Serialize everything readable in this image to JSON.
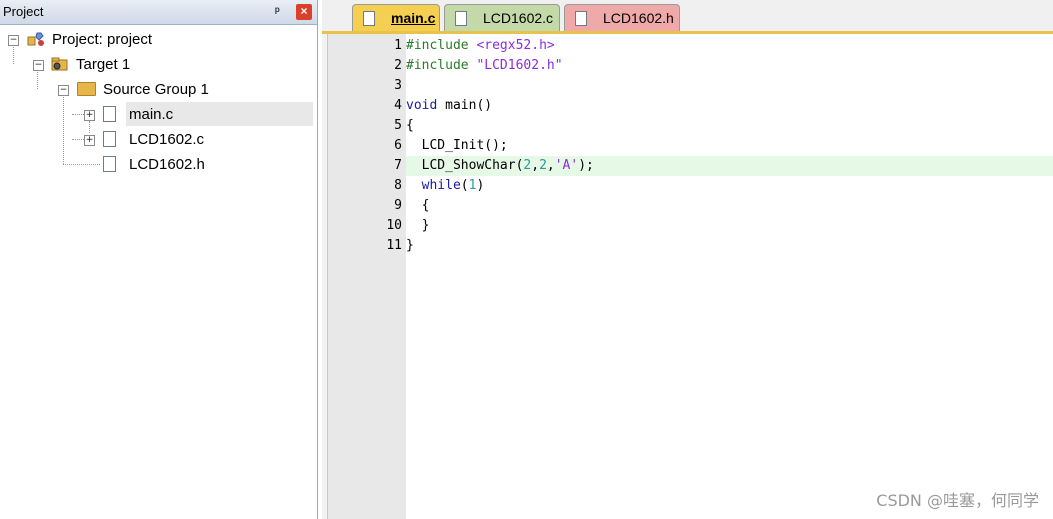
{
  "project_panel": {
    "title": "Project",
    "pin_glyph": "ᵖ",
    "close_glyph": "×",
    "tree": {
      "project": "Project: project",
      "target": "Target 1",
      "group": "Source Group 1",
      "files": [
        "main.c",
        "LCD1602.c",
        "LCD1602.h"
      ]
    }
  },
  "editor": {
    "tabs": [
      {
        "label": "main.c",
        "active": true,
        "color": "#f5cf52"
      },
      {
        "label": "LCD1602.c",
        "active": false,
        "color": "#c3d9a8"
      },
      {
        "label": "LCD1602.h",
        "active": false,
        "color": "#f0a9a9"
      }
    ],
    "highlighted_line": 7,
    "lines": [
      {
        "num": "1",
        "text": "#include <regx52.h>"
      },
      {
        "num": "2",
        "text": "#include \"LCD1602.h\""
      },
      {
        "num": "3",
        "text": ""
      },
      {
        "num": "4",
        "text": "void main()"
      },
      {
        "num": "5",
        "text": "{"
      },
      {
        "num": "6",
        "text": "  LCD_Init();"
      },
      {
        "num": "7",
        "text": "  LCD_ShowChar(2,2,'A');"
      },
      {
        "num": "8",
        "text": "  while(1)"
      },
      {
        "num": "9",
        "text": "  {"
      },
      {
        "num": "10",
        "text": "  }"
      },
      {
        "num": "11",
        "text": "}"
      }
    ]
  },
  "watermark": "CSDN @哇塞，何同学"
}
